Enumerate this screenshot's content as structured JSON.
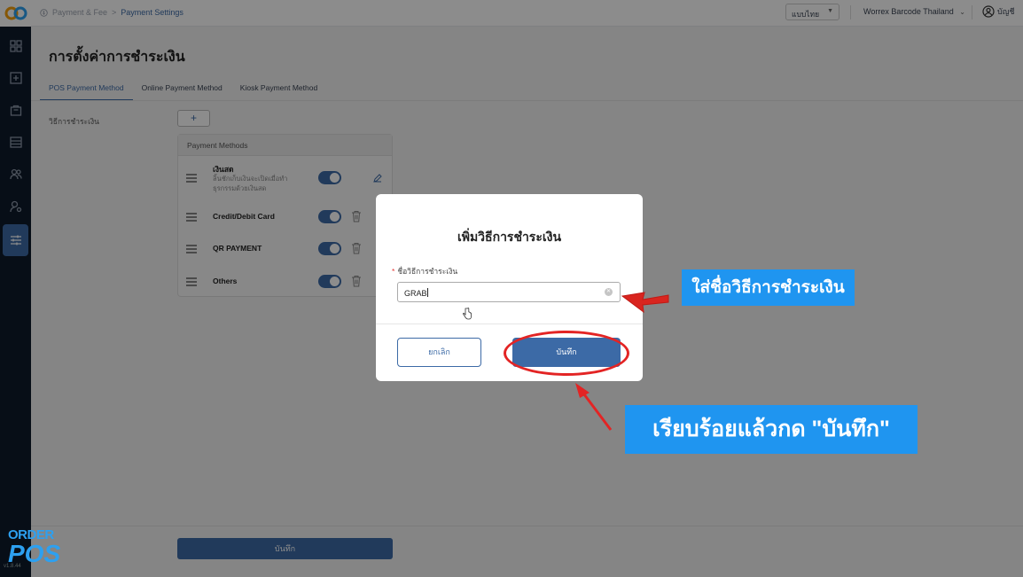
{
  "sidebar": {
    "items": [
      {
        "icon": "grid-icon"
      },
      {
        "icon": "pos-icon"
      },
      {
        "icon": "bag-icon"
      },
      {
        "icon": "inventory-icon"
      },
      {
        "icon": "users-icon"
      },
      {
        "icon": "user-settings-icon"
      },
      {
        "icon": "sliders-icon",
        "active": true
      }
    ],
    "version": "v1.8.44"
  },
  "topbar": {
    "breadcrumb": [
      "Payment & Fee",
      "Payment Settings"
    ],
    "language": "แบบไทย",
    "shop": "Worrex Barcode Thailand",
    "account": "บัญชี"
  },
  "page": {
    "title": "การตั้งค่าการชำระเงิน",
    "tabs": [
      "POS Payment Method",
      "Online Payment Method",
      "Kiosk Payment Method"
    ],
    "active_tab": "POS Payment Method",
    "field_label": "วิธีการชำระเงิน",
    "add_label": "+",
    "methods_header": "Payment Methods",
    "methods": [
      {
        "name": "เงินสด",
        "desc": "ลิ้นชักเก็บเงินจะเปิดเมื่อทำธุรกรรมด้วยเงินสด",
        "enabled": true
      },
      {
        "name": "Credit/Debit Card",
        "desc": "",
        "enabled": true
      },
      {
        "name": "QR PAYMENT",
        "desc": "",
        "enabled": true
      },
      {
        "name": "Others",
        "desc": "",
        "enabled": true
      }
    ],
    "save_label": "บันทึก"
  },
  "modal": {
    "title": "เพิ่มวิธีการชำระเงิน",
    "field_label": "ชื่อวิธีการชำระเงิน",
    "required_mark": "*",
    "input_value": "GRAB",
    "cancel_label": "ยกเลิก",
    "save_label": "บันทึก"
  },
  "annotations": {
    "callout_1": "ใส่ชื่อวิธีการชำระเงิน",
    "callout_2": "เรียบร้อยแล้วกด \"บันทึก\"",
    "highlight_color": "#e32424",
    "callout_color": "#1f95f0"
  },
  "brand": {
    "line1": "ORDER",
    "line2": "POS"
  },
  "colors": {
    "primary": "#3c6aa6",
    "sidebar": "#0e1a2b"
  }
}
